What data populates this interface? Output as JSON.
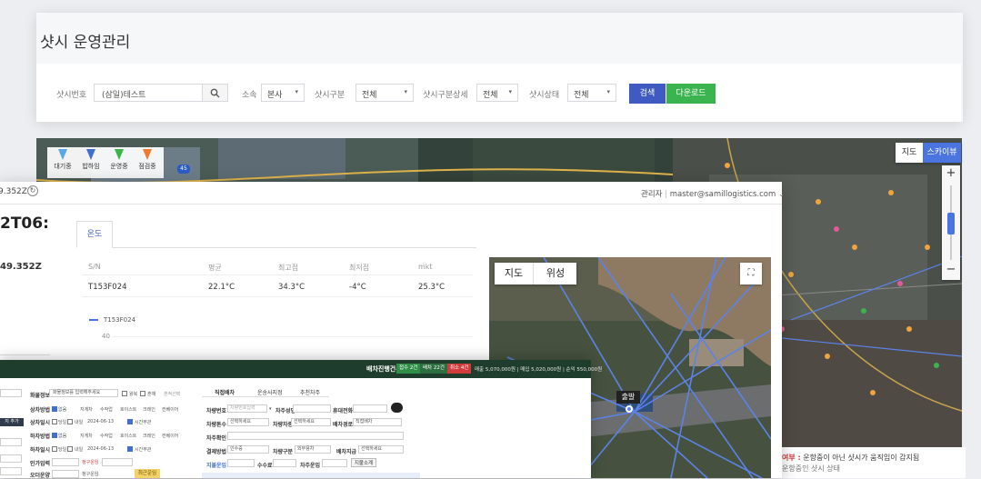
{
  "back": {
    "page_title": "샷시 운영관리",
    "filters": {
      "chassis_no_label": "샷시번호",
      "chassis_no_value": "(삼일)테스트",
      "affiliation_label": "소속",
      "affiliation_value": "본사",
      "type_label": "샷시구분",
      "type_value": "전체",
      "type_detail_label": "샷시구분상세",
      "type_detail_value": "전체",
      "status_label": "샷시상태",
      "status_value": "전체",
      "search_button": "검색",
      "download_button": "다운로드"
    },
    "map": {
      "legend": [
        "대기중",
        "밥하임",
        "운영중",
        "점검중"
      ],
      "legend_colors": [
        "#5aa6e6",
        "#3f6fd1",
        "#39b54a",
        "#f07b2f"
      ],
      "type_map": "지도",
      "type_satellite": "스카이뷰",
      "zoom_in": "+",
      "zoom_out": "−",
      "highway_no": "45",
      "info_prefix": "여부 :",
      "info_text": "운항중이 아닌 샷시가 움직임이 감지됨",
      "info_text2": "운항중인 샷시 상태"
    }
  },
  "middle": {
    "timestamp": "9.352Z",
    "user_role": "관리자",
    "user_email": "master@samillogistics.com",
    "title": "2T06:",
    "subtitle": "49.352Z",
    "tab_temp": "온도",
    "table": {
      "headers": [
        "S/N",
        "평균",
        "최고점",
        "최저점",
        "mkt"
      ],
      "rows": [
        [
          "T153F024",
          "22.1°C",
          "34.3°C",
          "-4°C",
          "25.3°C"
        ]
      ]
    },
    "chart_series": "T153F024",
    "chart_tick": "40",
    "map": {
      "type_map": "지도",
      "type_satellite": "위성",
      "depart_label": "출발"
    }
  },
  "front": {
    "title": "배차진행건수",
    "badges": [
      {
        "label": "접수 2건",
        "color": "#2f8f46"
      },
      {
        "label": "배차 22건",
        "color": "#2c6e3f"
      },
      {
        "label": "취소 4건",
        "color": "#d23b3b"
      }
    ],
    "stats": "매출 5,070,000원 | 매입 5,020,000원 | 순익 550,000원",
    "left_labels": [
      "화물정보",
      "상차방법",
      "상차일시",
      "하차방법",
      "하차일시",
      "인가입력",
      "오더운양"
    ],
    "left_values": {
      "cargo_placeholder": "화물정보를 입력해주세요",
      "round_trip": "왕복",
      "mixed": "혼재",
      "freight_option": "혼적선택",
      "methods": [
        "없음",
        "지게차",
        "수작업",
        "호이스트",
        "크레인",
        "컨베이어"
      ],
      "day_today": "당일",
      "day_tomorrow": "내일",
      "date1": "2024-06-13",
      "time_option": "시간무관",
      "extra_button": "지 추가",
      "request_amount_label": "청구운임",
      "contract_amount_label": "청구운임",
      "recent_button": "최근운임"
    },
    "right_tabs": [
      "직접배차",
      "운송사지정",
      "추천차주"
    ],
    "right_labels": [
      "차량번호",
      "차량톤수",
      "차주확인",
      "결제방법",
      "지불운임"
    ],
    "right_values": {
      "owner_name_label": "차주성명",
      "phone_label": "휴대전화",
      "vehicle_no_placeholder": "차량번호입력",
      "tonnage_select": "선택하세요",
      "type_label": "차량차종",
      "type_select": "선택하세요",
      "cargo_type_label": "배차경로",
      "cargo_type_value": "직접배차",
      "pay_select": "인수증",
      "pay_class_label": "차량구분",
      "pay_class_value": "외부용차",
      "pay_time_label": "배차지급",
      "pay_time_value": "선택하세요",
      "fee_label": "수수료",
      "owner_fee_label": "차주운임",
      "intro_button": "지불소계"
    }
  }
}
